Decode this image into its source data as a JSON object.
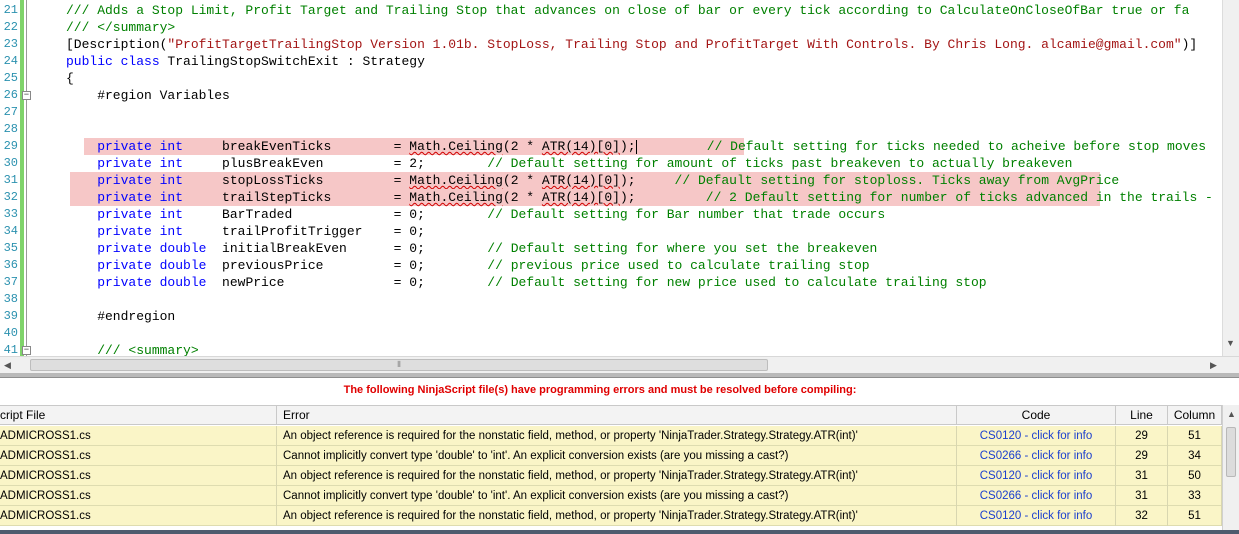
{
  "editor": {
    "lines": [
      {
        "num": "21",
        "fold": "",
        "parts": [
          {
            "c": "cm",
            "t": "/// Adds a Stop Limit, Profit Target and Trailing Stop that advances on close of bar or every tick according to CalculateOnCloseOfBar true or fa"
          }
        ]
      },
      {
        "num": "22",
        "fold": "",
        "parts": [
          {
            "c": "cm",
            "t": "/// </summary>"
          }
        ]
      },
      {
        "num": "23",
        "fold": "",
        "parts": [
          {
            "c": "",
            "t": "[Description("
          },
          {
            "c": "st",
            "t": "\"ProfitTargetTrailingStop Version 1.01b. StopLoss, Trailing Stop and ProfitTarget With Controls. By Chris Long. alcamie@gmail.com\""
          },
          {
            "c": "",
            "t": ")]"
          }
        ]
      },
      {
        "num": "24",
        "fold": "",
        "parts": [
          {
            "c": "kw",
            "t": "public class"
          },
          {
            "c": "",
            "t": " TrailingStopSwitchExit : Strategy"
          }
        ]
      },
      {
        "num": "25",
        "fold": "",
        "parts": [
          {
            "c": "",
            "t": "{"
          }
        ]
      },
      {
        "num": "26",
        "fold": "−",
        "parts": [
          {
            "c": "",
            "t": "    #region Variables"
          }
        ]
      },
      {
        "num": "27",
        "fold": "",
        "parts": []
      },
      {
        "num": "28",
        "fold": "",
        "parts": []
      },
      {
        "num": "29",
        "fold": "",
        "hl": [
          84,
          744
        ],
        "caret": true,
        "parts": [
          {
            "c": "kw",
            "t": "    private int"
          },
          {
            "c": "",
            "t": "     breakEvenTicks        = "
          },
          {
            "c": "sq",
            "t": "Math.Ceiling"
          },
          {
            "c": "",
            "t": "(2 * "
          },
          {
            "c": "sq",
            "t": "ATR(14)[0]"
          },
          {
            "c": "",
            "t": ");"
          },
          {
            "c": "caret",
            "t": ""
          },
          {
            "c": "",
            "t": "         "
          },
          {
            "c": "cm",
            "t": "// Default setting for ticks needed to acheive before stop moves"
          }
        ]
      },
      {
        "num": "30",
        "fold": "",
        "parts": [
          {
            "c": "kw",
            "t": "    private int"
          },
          {
            "c": "",
            "t": "     plusBreakEven         = 2;        "
          },
          {
            "c": "cm",
            "t": "// Default setting for amount of ticks past breakeven to actually breakeven"
          }
        ]
      },
      {
        "num": "31",
        "fold": "",
        "hl": [
          70,
          1100
        ],
        "parts": [
          {
            "c": "kw",
            "t": "    private int"
          },
          {
            "c": "",
            "t": "     stopLossTicks         = "
          },
          {
            "c": "sq",
            "t": "Math.Ceiling"
          },
          {
            "c": "",
            "t": "(2 * "
          },
          {
            "c": "sq",
            "t": "ATR(14)[0]"
          },
          {
            "c": "",
            "t": ");     "
          },
          {
            "c": "cm",
            "t": "// Default setting for stoploss. Ticks away from AvgPrice"
          }
        ]
      },
      {
        "num": "32",
        "fold": "",
        "hl": [
          70,
          1100
        ],
        "parts": [
          {
            "c": "kw",
            "t": "    private int"
          },
          {
            "c": "",
            "t": "     trailStepTicks        = "
          },
          {
            "c": "sq",
            "t": "Math.Ceiling"
          },
          {
            "c": "",
            "t": "(2 * "
          },
          {
            "c": "sq",
            "t": "ATR(14)[0]"
          },
          {
            "c": "",
            "t": ");         "
          },
          {
            "c": "cm",
            "t": "// 2 Default setting for number of ticks advanced in the trails -"
          }
        ]
      },
      {
        "num": "33",
        "fold": "",
        "parts": [
          {
            "c": "kw",
            "t": "    private int"
          },
          {
            "c": "",
            "t": "     BarTraded             = 0;        "
          },
          {
            "c": "cm",
            "t": "// Default setting for Bar number that trade occurs"
          }
        ]
      },
      {
        "num": "34",
        "fold": "",
        "parts": [
          {
            "c": "kw",
            "t": "    private int"
          },
          {
            "c": "",
            "t": "     trailProfitTrigger    = 0;"
          }
        ]
      },
      {
        "num": "35",
        "fold": "",
        "parts": [
          {
            "c": "kw",
            "t": "    private double"
          },
          {
            "c": "",
            "t": "  initialBreakEven      = 0;        "
          },
          {
            "c": "cm",
            "t": "// Default setting for where you set the breakeven"
          }
        ]
      },
      {
        "num": "36",
        "fold": "",
        "parts": [
          {
            "c": "kw",
            "t": "    private double"
          },
          {
            "c": "",
            "t": "  previousPrice         = 0;        "
          },
          {
            "c": "cm",
            "t": "// previous price used to calculate trailing stop"
          }
        ]
      },
      {
        "num": "37",
        "fold": "",
        "parts": [
          {
            "c": "kw",
            "t": "    private double"
          },
          {
            "c": "",
            "t": "  newPrice              = 0;        "
          },
          {
            "c": "cm",
            "t": "// Default setting for new price used to calculate trailing stop"
          }
        ]
      },
      {
        "num": "38",
        "fold": "",
        "parts": []
      },
      {
        "num": "39",
        "fold": "",
        "parts": [
          {
            "c": "",
            "t": "    #endregion"
          }
        ]
      },
      {
        "num": "40",
        "fold": "",
        "parts": []
      },
      {
        "num": "41",
        "fold": "−",
        "parts": [
          {
            "c": "cm",
            "t": "    /// <summary>"
          }
        ]
      }
    ]
  },
  "errors": {
    "banner": "The following NinjaScript file(s) have programming errors and must be resolved before compiling:",
    "columns": [
      "cript File",
      "Error",
      "Code",
      "Line",
      "Column"
    ],
    "rows": [
      {
        "file": "ADMICROSS1.cs",
        "error": "An object reference is required for the nonstatic field, method, or property 'NinjaTrader.Strategy.Strategy.ATR(int)'",
        "code": "CS0120 - click for info",
        "line": "29",
        "column": "51"
      },
      {
        "file": "ADMICROSS1.cs",
        "error": "Cannot implicitly convert type 'double' to 'int'. An explicit conversion exists (are you missing a cast?)",
        "code": "CS0266 - click for info",
        "line": "29",
        "column": "34"
      },
      {
        "file": "ADMICROSS1.cs",
        "error": "An object reference is required for the nonstatic field, method, or property 'NinjaTrader.Strategy.Strategy.ATR(int)'",
        "code": "CS0120 - click for info",
        "line": "31",
        "column": "50"
      },
      {
        "file": "ADMICROSS1.cs",
        "error": "Cannot implicitly convert type 'double' to 'int'. An explicit conversion exists (are you missing a cast?)",
        "code": "CS0266 - click for info",
        "line": "31",
        "column": "33"
      },
      {
        "file": "ADMICROSS1.cs",
        "error": "An object reference is required for the nonstatic field, method, or property 'NinjaTrader.Strategy.Strategy.ATR(int)'",
        "code": "CS0120 - click for info",
        "line": "32",
        "column": "51"
      }
    ]
  },
  "scroll": {
    "grip": "⦀"
  },
  "colors": {
    "error_banner": "#e00000",
    "row_bg": "#faf5c7",
    "link": "#1b3fcf",
    "keyword": "#0000ff",
    "comment": "#008000",
    "highlight": "#f6c7c7"
  }
}
